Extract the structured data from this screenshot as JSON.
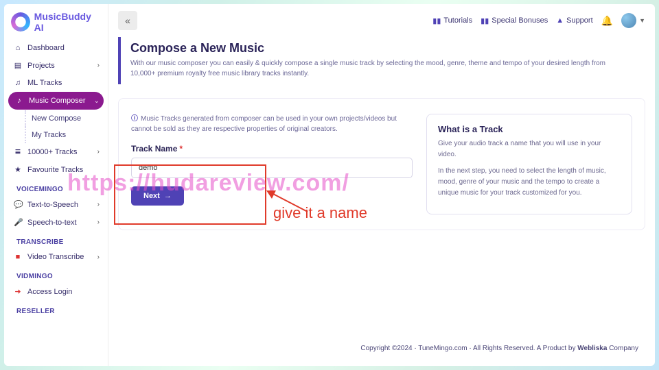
{
  "brand": {
    "name_a": "MusicBuddy",
    "name_b": " AI"
  },
  "sidebar": {
    "items": [
      {
        "icon": "⌂",
        "label": "Dashboard"
      },
      {
        "icon": "▤",
        "label": "Projects",
        "has_chev": true
      },
      {
        "icon": "♫",
        "label": "ML Tracks"
      },
      {
        "icon": "♪",
        "label": "Music Composer",
        "active": true,
        "has_chev": true
      },
      {
        "icon": "≣",
        "label": "10000+ Tracks",
        "has_chev": true
      },
      {
        "icon": "★",
        "label": "Favourite Tracks"
      }
    ],
    "composer_sub": [
      {
        "label": "New Compose"
      },
      {
        "label": "My Tracks"
      }
    ],
    "sections": [
      {
        "head": "VOICEMINGO",
        "items": [
          {
            "icon": "💬",
            "label": "Text-to-Speech",
            "has_chev": true
          },
          {
            "icon": "🎤",
            "label": "Speech-to-text",
            "has_chev": true
          }
        ]
      },
      {
        "head": "TRANSCRIBE",
        "items": [
          {
            "icon": "■",
            "label": "Video Transcribe",
            "has_chev": true
          }
        ]
      },
      {
        "head": "VIDMINGO",
        "items": [
          {
            "icon": "➜",
            "label": "Access Login"
          }
        ]
      },
      {
        "head": "RESELLER",
        "items": []
      }
    ]
  },
  "topnav": {
    "tutorials": "Tutorials",
    "bonuses": "Special Bonuses",
    "support": "Support"
  },
  "hero": {
    "title": "Compose a New Music",
    "subtitle": "With our music composer you can easily & quickly compose a single music track by selecting the mood, genre, theme and tempo of your desired length from 10,000+ premium royalty free music library tracks instantly."
  },
  "composer": {
    "info": "Music Tracks generated from composer can be used in your own projects/videos but cannot be sold as they are respective properties of original creators.",
    "track_label": "Track Name",
    "track_value": "demo",
    "next_label": "Next"
  },
  "info_card": {
    "title": "What is a Track",
    "p1": "Give your audio track a name that you will use in your video.",
    "p2": "In the next step, you need to select the length of music, mood, genre of your music and the tempo to create a unique music for your track customized for you."
  },
  "footer": {
    "text_a": "Copyright ©2024 · TuneMingo.com · All Rights Reserved. A Product by ",
    "brand": "Webliska",
    "text_b": " Company"
  },
  "annotation": {
    "label": "give it a name"
  },
  "watermark": "https://hudareview.com/"
}
